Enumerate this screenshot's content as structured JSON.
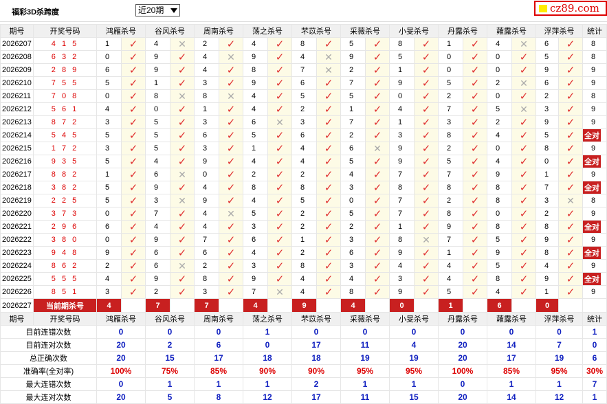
{
  "page_title": "福彩3D杀跨度",
  "period_select": "近20期",
  "logo": "cz89.com",
  "headers": [
    "期号",
    "开奖号码",
    "鸿雁杀号",
    "谷风杀号",
    "周南杀号",
    "荡之杀号",
    "芣苡杀号",
    "采薇杀号",
    "小旻杀号",
    "丹露杀号",
    "蕹露杀号",
    "浮萍杀号",
    "统计"
  ],
  "rows": [
    {
      "p": "2026207",
      "d": "4 1 5",
      "k": [
        [
          1,
          1
        ],
        [
          4,
          0
        ],
        [
          2,
          1
        ],
        [
          4,
          1
        ],
        [
          8,
          1
        ],
        [
          5,
          1
        ],
        [
          8,
          1
        ],
        [
          1,
          1
        ],
        [
          4,
          0
        ],
        [
          6,
          1
        ]
      ],
      "c": "8"
    },
    {
      "p": "2026208",
      "d": "6 3 2",
      "k": [
        [
          0,
          1
        ],
        [
          9,
          1
        ],
        [
          4,
          0
        ],
        [
          9,
          1
        ],
        [
          4,
          0
        ],
        [
          9,
          1
        ],
        [
          5,
          1
        ],
        [
          0,
          1
        ],
        [
          0,
          1
        ],
        [
          5,
          1
        ]
      ],
      "c": "8"
    },
    {
      "p": "2026209",
      "d": "2 8 9",
      "k": [
        [
          6,
          1
        ],
        [
          9,
          1
        ],
        [
          4,
          1
        ],
        [
          8,
          1
        ],
        [
          7,
          0
        ],
        [
          2,
          1
        ],
        [
          1,
          1
        ],
        [
          0,
          1
        ],
        [
          0,
          1
        ],
        [
          9,
          1
        ]
      ],
      "c": "9"
    },
    {
      "p": "2026210",
      "d": "7 5 5",
      "k": [
        [
          5,
          1
        ],
        [
          1,
          1
        ],
        [
          3,
          1
        ],
        [
          9,
          1
        ],
        [
          6,
          1
        ],
        [
          7,
          1
        ],
        [
          9,
          1
        ],
        [
          5,
          1
        ],
        [
          2,
          0
        ],
        [
          6,
          1
        ]
      ],
      "c": "9"
    },
    {
      "p": "2026211",
      "d": "7 0 8",
      "k": [
        [
          0,
          1
        ],
        [
          8,
          0
        ],
        [
          8,
          0
        ],
        [
          4,
          1
        ],
        [
          5,
          1
        ],
        [
          5,
          1
        ],
        [
          0,
          1
        ],
        [
          2,
          1
        ],
        [
          0,
          1
        ],
        [
          2,
          1
        ]
      ],
      "c": "8"
    },
    {
      "p": "2026212",
      "d": "5 6 1",
      "k": [
        [
          4,
          1
        ],
        [
          0,
          1
        ],
        [
          1,
          1
        ],
        [
          4,
          1
        ],
        [
          2,
          1
        ],
        [
          1,
          1
        ],
        [
          4,
          1
        ],
        [
          7,
          1
        ],
        [
          5,
          0
        ],
        [
          3,
          1
        ]
      ],
      "c": "9"
    },
    {
      "p": "2026213",
      "d": "8 7 2",
      "k": [
        [
          3,
          1
        ],
        [
          5,
          1
        ],
        [
          3,
          1
        ],
        [
          6,
          0
        ],
        [
          3,
          1
        ],
        [
          7,
          1
        ],
        [
          1,
          1
        ],
        [
          3,
          1
        ],
        [
          2,
          1
        ],
        [
          9,
          1
        ]
      ],
      "c": "9"
    },
    {
      "p": "2026214",
      "d": "5 4 5",
      "k": [
        [
          5,
          1
        ],
        [
          5,
          1
        ],
        [
          6,
          1
        ],
        [
          5,
          1
        ],
        [
          6,
          1
        ],
        [
          2,
          1
        ],
        [
          3,
          1
        ],
        [
          8,
          1
        ],
        [
          4,
          1
        ],
        [
          5,
          1
        ]
      ],
      "c": "全对"
    },
    {
      "p": "2026215",
      "d": "1 7 2",
      "k": [
        [
          3,
          1
        ],
        [
          5,
          1
        ],
        [
          3,
          1
        ],
        [
          1,
          1
        ],
        [
          4,
          1
        ],
        [
          6,
          0
        ],
        [
          9,
          1
        ],
        [
          2,
          1
        ],
        [
          0,
          1
        ],
        [
          8,
          1
        ]
      ],
      "c": "9"
    },
    {
      "p": "2026216",
      "d": "9 3 5",
      "k": [
        [
          5,
          1
        ],
        [
          4,
          1
        ],
        [
          9,
          1
        ],
        [
          4,
          1
        ],
        [
          4,
          1
        ],
        [
          5,
          1
        ],
        [
          9,
          1
        ],
        [
          5,
          1
        ],
        [
          4,
          1
        ],
        [
          0,
          1
        ]
      ],
      "c": "全对"
    },
    {
      "p": "2026217",
      "d": "8 8 2",
      "k": [
        [
          1,
          1
        ],
        [
          6,
          0
        ],
        [
          0,
          1
        ],
        [
          2,
          1
        ],
        [
          2,
          1
        ],
        [
          4,
          1
        ],
        [
          7,
          1
        ],
        [
          7,
          1
        ],
        [
          9,
          1
        ],
        [
          1,
          1
        ]
      ],
      "c": "9"
    },
    {
      "p": "2026218",
      "d": "3 8 2",
      "k": [
        [
          5,
          1
        ],
        [
          9,
          1
        ],
        [
          4,
          1
        ],
        [
          8,
          1
        ],
        [
          8,
          1
        ],
        [
          3,
          1
        ],
        [
          8,
          1
        ],
        [
          8,
          1
        ],
        [
          8,
          1
        ],
        [
          7,
          1
        ]
      ],
      "c": "全对"
    },
    {
      "p": "2026219",
      "d": "2 2 5",
      "k": [
        [
          5,
          1
        ],
        [
          3,
          0
        ],
        [
          9,
          1
        ],
        [
          4,
          1
        ],
        [
          5,
          1
        ],
        [
          0,
          1
        ],
        [
          7,
          1
        ],
        [
          2,
          1
        ],
        [
          8,
          1
        ],
        [
          3,
          0
        ]
      ],
      "c": "8"
    },
    {
      "p": "2026220",
      "d": "3 7 3",
      "k": [
        [
          0,
          1
        ],
        [
          7,
          1
        ],
        [
          4,
          0
        ],
        [
          5,
          1
        ],
        [
          2,
          1
        ],
        [
          5,
          1
        ],
        [
          7,
          1
        ],
        [
          8,
          1
        ],
        [
          0,
          1
        ],
        [
          2,
          1
        ]
      ],
      "c": "9"
    },
    {
      "p": "2026221",
      "d": "2 9 6",
      "k": [
        [
          6,
          1
        ],
        [
          4,
          1
        ],
        [
          4,
          1
        ],
        [
          3,
          1
        ],
        [
          2,
          1
        ],
        [
          2,
          1
        ],
        [
          1,
          1
        ],
        [
          9,
          1
        ],
        [
          8,
          1
        ],
        [
          8,
          1
        ]
      ],
      "c": "全对"
    },
    {
      "p": "2026222",
      "d": "3 8 0",
      "k": [
        [
          0,
          1
        ],
        [
          9,
          1
        ],
        [
          7,
          1
        ],
        [
          6,
          1
        ],
        [
          1,
          1
        ],
        [
          3,
          1
        ],
        [
          8,
          0
        ],
        [
          7,
          1
        ],
        [
          5,
          1
        ],
        [
          9,
          1
        ]
      ],
      "c": "9"
    },
    {
      "p": "2026223",
      "d": "9 4 8",
      "k": [
        [
          9,
          1
        ],
        [
          6,
          1
        ],
        [
          6,
          1
        ],
        [
          4,
          1
        ],
        [
          2,
          1
        ],
        [
          6,
          1
        ],
        [
          9,
          1
        ],
        [
          1,
          1
        ],
        [
          9,
          1
        ],
        [
          8,
          1
        ]
      ],
      "c": "全对"
    },
    {
      "p": "2026224",
      "d": "8 6 2",
      "k": [
        [
          2,
          1
        ],
        [
          6,
          0
        ],
        [
          2,
          1
        ],
        [
          3,
          1
        ],
        [
          8,
          1
        ],
        [
          3,
          1
        ],
        [
          4,
          1
        ],
        [
          4,
          1
        ],
        [
          5,
          1
        ],
        [
          4,
          1
        ]
      ],
      "c": "9"
    },
    {
      "p": "2026225",
      "d": "5 5 5",
      "k": [
        [
          4,
          1
        ],
        [
          9,
          1
        ],
        [
          8,
          1
        ],
        [
          9,
          1
        ],
        [
          4,
          1
        ],
        [
          4,
          1
        ],
        [
          3,
          1
        ],
        [
          4,
          1
        ],
        [
          8,
          1
        ],
        [
          9,
          1
        ]
      ],
      "c": "全对"
    },
    {
      "p": "2026226",
      "d": "8 5 1",
      "k": [
        [
          3,
          1
        ],
        [
          2,
          1
        ],
        [
          3,
          1
        ],
        [
          7,
          0
        ],
        [
          4,
          1
        ],
        [
          8,
          1
        ],
        [
          9,
          1
        ],
        [
          5,
          1
        ],
        [
          4,
          1
        ],
        [
          1,
          1
        ]
      ],
      "c": "9"
    }
  ],
  "current": {
    "p": "2026227",
    "label": "当前期杀号",
    "k": [
      "4",
      "7",
      "7",
      "4",
      "9",
      "4",
      "0",
      "1",
      "6",
      "0"
    ]
  },
  "stats": [
    {
      "label": "目前连错次数",
      "v": [
        "0",
        "0",
        "0",
        "1",
        "0",
        "0",
        "0",
        "0",
        "0",
        "0",
        "1"
      ],
      "red": false
    },
    {
      "label": "目前连对次数",
      "v": [
        "20",
        "2",
        "6",
        "0",
        "17",
        "11",
        "4",
        "20",
        "14",
        "7",
        "0"
      ],
      "red": false
    },
    {
      "label": "总正确次数",
      "v": [
        "20",
        "15",
        "17",
        "18",
        "18",
        "19",
        "19",
        "20",
        "17",
        "19",
        "6"
      ],
      "red": false
    },
    {
      "label": "准确率(全对率)",
      "v": [
        "100%",
        "75%",
        "85%",
        "90%",
        "90%",
        "95%",
        "95%",
        "100%",
        "85%",
        "95%",
        "30%"
      ],
      "red": true
    },
    {
      "label": "最大连错次数",
      "v": [
        "0",
        "1",
        "1",
        "1",
        "2",
        "1",
        "1",
        "0",
        "1",
        "1",
        "7"
      ],
      "red": false
    },
    {
      "label": "最大连对次数",
      "v": [
        "20",
        "5",
        "8",
        "12",
        "17",
        "11",
        "15",
        "20",
        "14",
        "12",
        "1"
      ],
      "red": false
    }
  ]
}
